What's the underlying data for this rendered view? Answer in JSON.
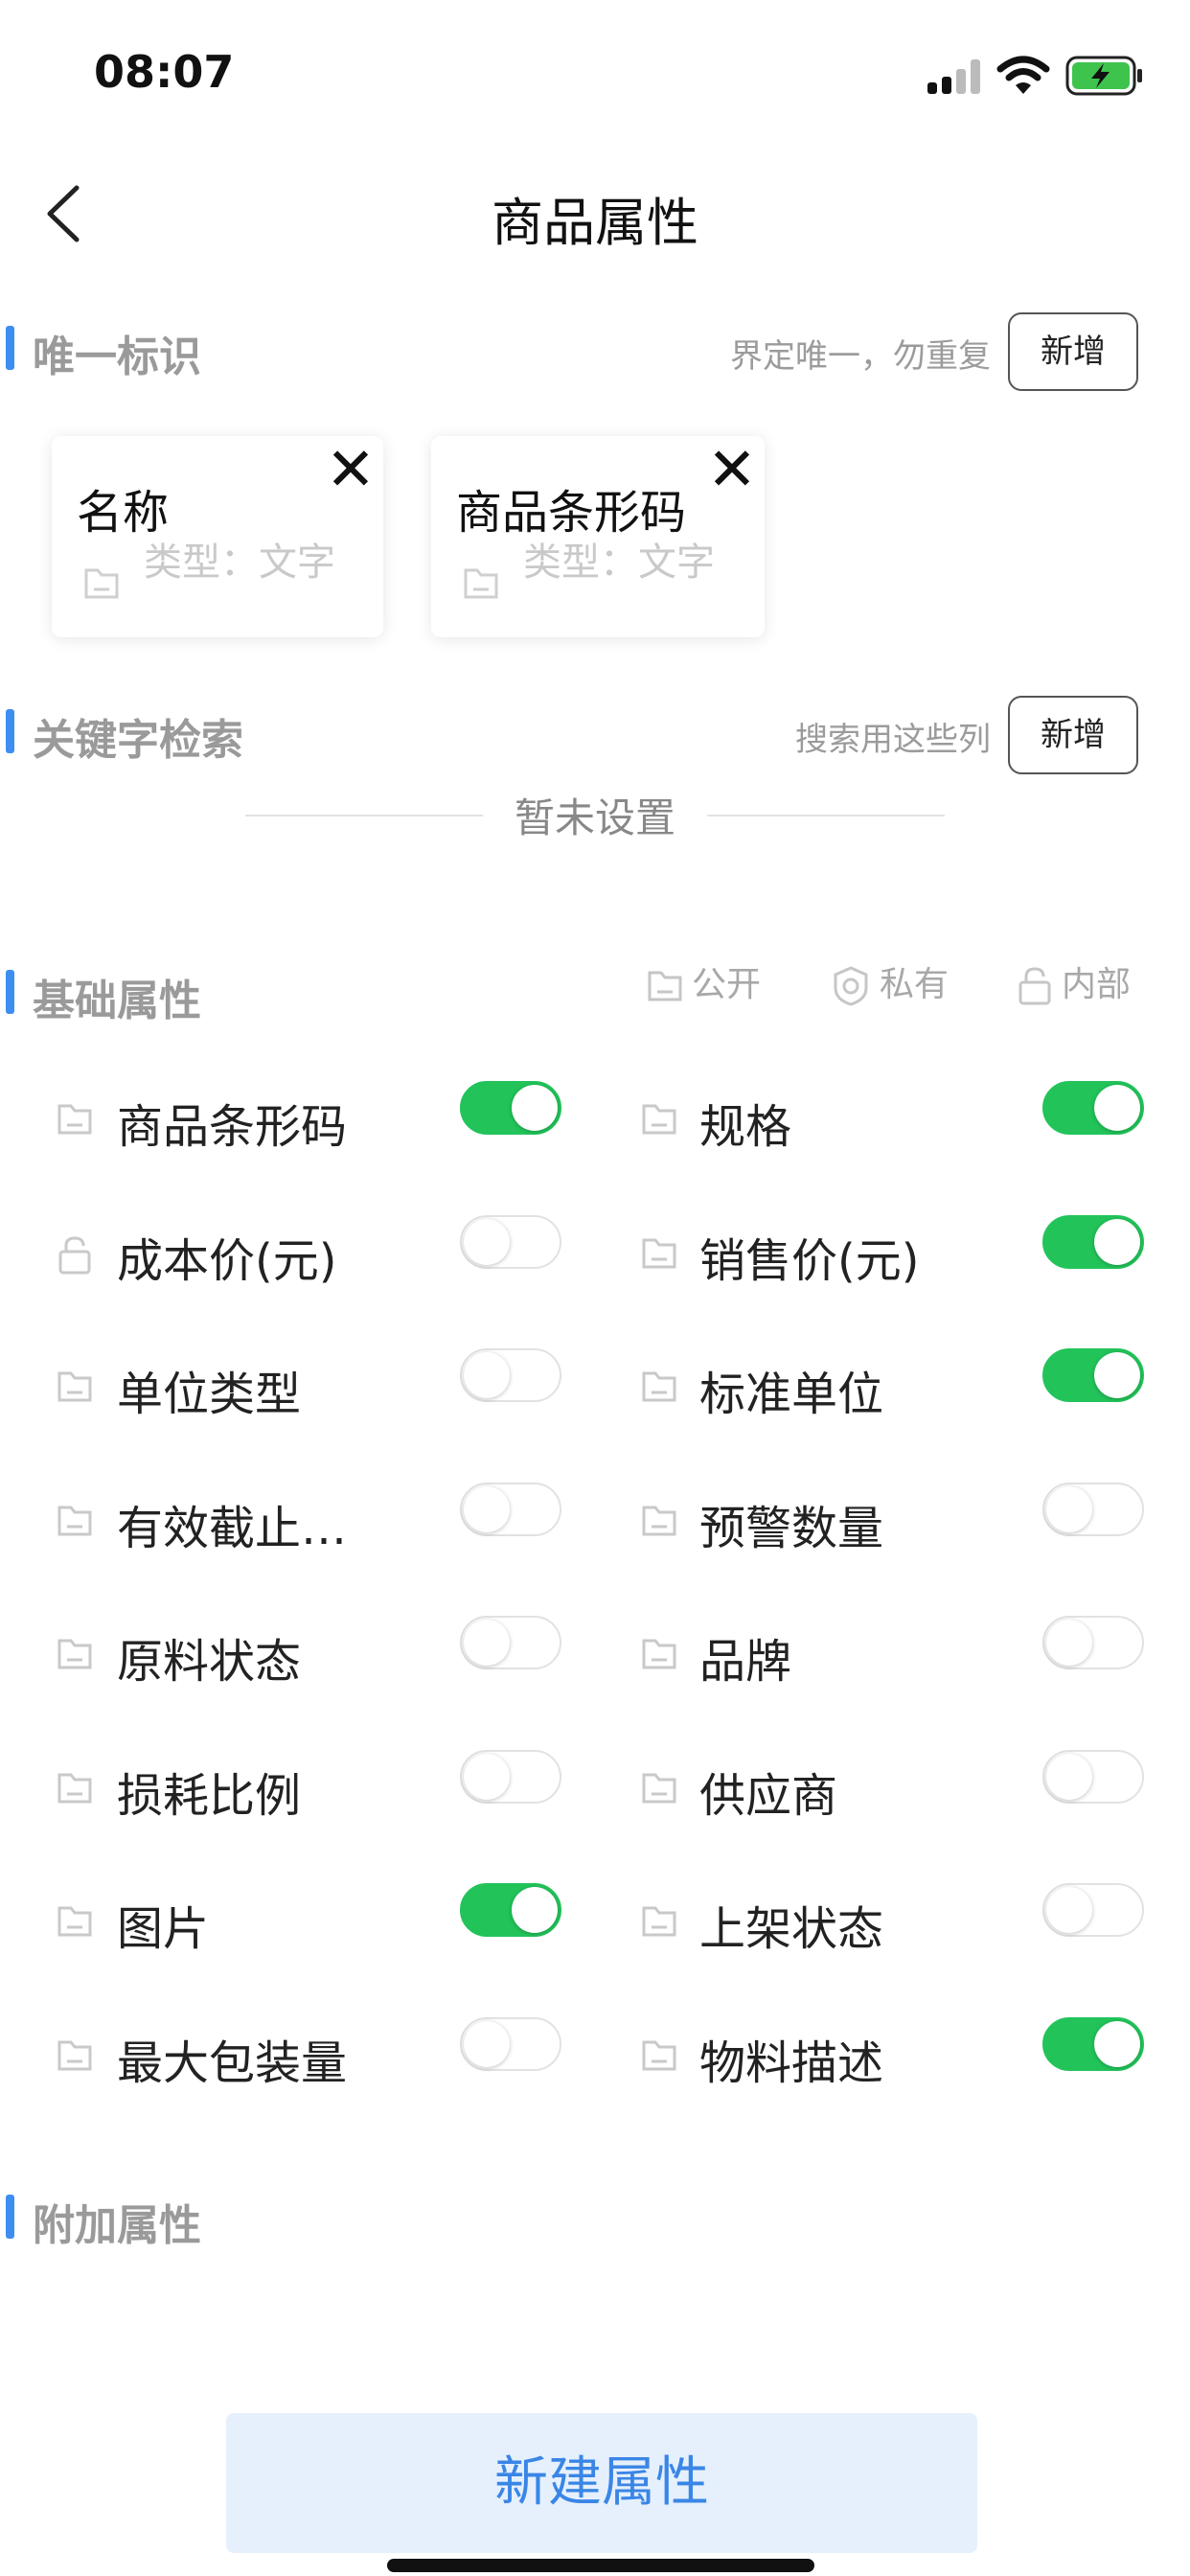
{
  "status": {
    "time": "08:07"
  },
  "nav": {
    "title": "商品属性"
  },
  "unique": {
    "title": "唯一标识",
    "hint": "界定唯一，勿重复",
    "add_label": "新增",
    "cards": [
      {
        "name": "名称",
        "type": "类型：文字"
      },
      {
        "name": "商品条形码",
        "type": "类型：文字"
      }
    ]
  },
  "keyword": {
    "title": "关键字检索",
    "hint": "搜索用这些列",
    "add_label": "新增",
    "empty": "暂未设置"
  },
  "basic": {
    "title": "基础属性",
    "legend": {
      "public": "公开",
      "private": "私有",
      "internal": "内部"
    },
    "items": [
      {
        "label": "商品条形码",
        "on": true,
        "icon": "doc-icon"
      },
      {
        "label": "规格",
        "on": true,
        "icon": "doc-icon"
      },
      {
        "label": "成本价(元)",
        "on": false,
        "icon": "lock-icon"
      },
      {
        "label": "销售价(元)",
        "on": true,
        "icon": "doc-icon"
      },
      {
        "label": "单位类型",
        "on": false,
        "icon": "doc-icon"
      },
      {
        "label": "标准单位",
        "on": true,
        "icon": "doc-icon"
      },
      {
        "label": "有效截止…",
        "on": false,
        "icon": "doc-icon"
      },
      {
        "label": "预警数量",
        "on": false,
        "icon": "doc-icon"
      },
      {
        "label": "原料状态",
        "on": false,
        "icon": "doc-icon"
      },
      {
        "label": "品牌",
        "on": false,
        "icon": "doc-icon"
      },
      {
        "label": "损耗比例",
        "on": false,
        "icon": "doc-icon"
      },
      {
        "label": "供应商",
        "on": false,
        "icon": "doc-icon"
      },
      {
        "label": "图片",
        "on": true,
        "icon": "doc-icon"
      },
      {
        "label": "上架状态",
        "on": false,
        "icon": "doc-icon"
      },
      {
        "label": "最大包装量",
        "on": false,
        "icon": "doc-icon"
      },
      {
        "label": "物料描述",
        "on": true,
        "icon": "doc-icon"
      }
    ]
  },
  "extra": {
    "title": "附加属性"
  },
  "bottom": {
    "new_label": "新建属性"
  },
  "colors": {
    "accent": "#3d8ef0",
    "toggle_on": "#22c45a",
    "button_bg": "#e6f0fd"
  }
}
